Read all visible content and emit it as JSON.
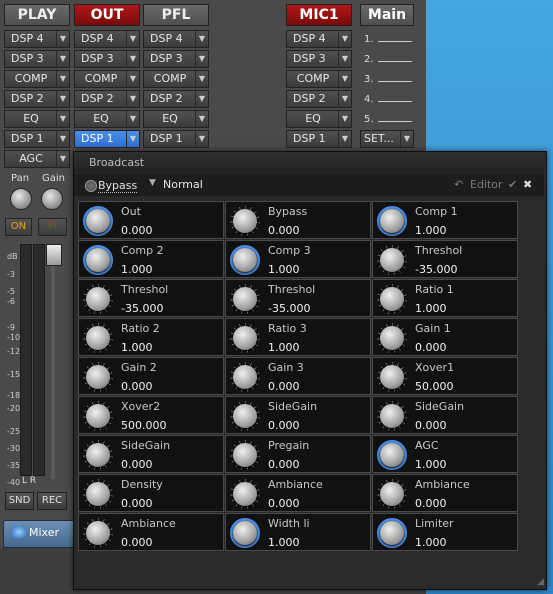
{
  "channels": [
    {
      "id": "play",
      "title": "PLAY",
      "style": "gray",
      "slots": [
        "DSP 4",
        "DSP 3",
        "COMP",
        "DSP 2",
        "EQ",
        "DSP 1",
        "AGC"
      ]
    },
    {
      "id": "out",
      "title": "OUT",
      "style": "red",
      "slots": [
        "DSP 4",
        "DSP 3",
        "COMP",
        "DSP 2",
        "EQ",
        "DSP 1"
      ]
    },
    {
      "id": "pfl",
      "title": "PFL",
      "style": "gray",
      "slots": [
        "DSP 4",
        "DSP 3",
        "COMP",
        "DSP 2",
        "EQ",
        "DSP 1"
      ]
    },
    {
      "id": "mic1",
      "title": "MIC1",
      "style": "red",
      "slots": [
        "DSP 4",
        "DSP 3",
        "COMP",
        "DSP 2",
        "EQ",
        "DSP 1"
      ]
    }
  ],
  "main": {
    "title": "Main",
    "lines": [
      "1.",
      "2.",
      "3.",
      "4.",
      "5."
    ],
    "setup_label": "SET..."
  },
  "play_controls": {
    "pan_label": "Pan",
    "gain_label": "Gain",
    "on_label": "ON",
    "m_label": "M",
    "db_labels": [
      "dB",
      "-3",
      "-5",
      "-6",
      "-9",
      "-10",
      "-12",
      "-15",
      "-18",
      "-20",
      "-25",
      "-30",
      "-35",
      "-40"
    ],
    "lr_label": "L R",
    "snd_label": "SND",
    "rec_label": "REC"
  },
  "tab": {
    "label": "Mixer"
  },
  "window": {
    "title": "Broadcast",
    "bypass_label": "Bypass",
    "preset": "Normal",
    "editor_label": "Editor",
    "params": [
      {
        "name": "Out",
        "value": "0.000",
        "active": true
      },
      {
        "name": "Bypass",
        "value": "0.000",
        "active": false
      },
      {
        "name": "Comp 1",
        "value": "1.000",
        "active": true
      },
      {
        "name": "Comp 2",
        "value": "1.000",
        "active": true
      },
      {
        "name": "Comp 3",
        "value": "1.000",
        "active": true
      },
      {
        "name": "Threshol",
        "value": "-35.000",
        "active": false
      },
      {
        "name": "Threshol",
        "value": "-35.000",
        "active": false
      },
      {
        "name": "Threshol",
        "value": "-35.000",
        "active": false
      },
      {
        "name": "Ratio 1",
        "value": "1.000",
        "active": false
      },
      {
        "name": "Ratio 2",
        "value": "1.000",
        "active": false
      },
      {
        "name": "Ratio 3",
        "value": "1.000",
        "active": false
      },
      {
        "name": "Gain 1",
        "value": "0.000",
        "active": false
      },
      {
        "name": "Gain 2",
        "value": "0.000",
        "active": false
      },
      {
        "name": "Gain 3",
        "value": "0.000",
        "active": false
      },
      {
        "name": "Xover1",
        "value": "50.000",
        "active": false
      },
      {
        "name": "Xover2",
        "value": "500.000",
        "active": false
      },
      {
        "name": "SideGain",
        "value": "0.000",
        "active": false
      },
      {
        "name": "SideGain",
        "value": "0.000",
        "active": false
      },
      {
        "name": "SideGain",
        "value": "0.000",
        "active": false
      },
      {
        "name": "Pregain",
        "value": "0.000",
        "active": false
      },
      {
        "name": "AGC",
        "value": "1.000",
        "active": true
      },
      {
        "name": "Density",
        "value": "0.000",
        "active": false
      },
      {
        "name": "Ambiance",
        "value": "0.000",
        "active": false
      },
      {
        "name": "Ambiance",
        "value": "0.000",
        "active": false
      },
      {
        "name": "Ambiance",
        "value": "0.000",
        "active": false
      },
      {
        "name": "Width li",
        "value": "1.000",
        "active": true
      },
      {
        "name": "Limiter",
        "value": "1.000",
        "active": true
      }
    ]
  },
  "colors": {
    "accent": "#4b8ce0",
    "out_red": "#a01414",
    "selected": "#3a7fdc"
  }
}
